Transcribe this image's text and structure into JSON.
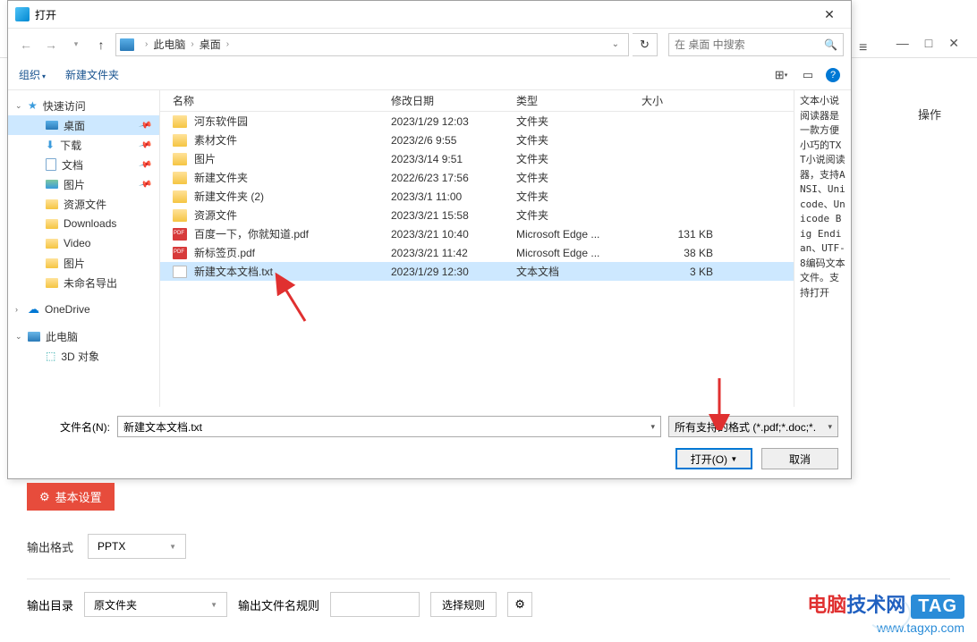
{
  "bg": {
    "operation_label": "操作"
  },
  "dialog": {
    "title": "打开",
    "breadcrumb": {
      "root": "此电脑",
      "folder": "桌面"
    },
    "search_placeholder": "在 桌面 中搜索",
    "toolbar": {
      "organize": "组织",
      "newfolder": "新建文件夹"
    },
    "columns": {
      "name": "名称",
      "date": "修改日期",
      "type": "类型",
      "size": "大小"
    },
    "sidebar": {
      "quick": "快速访问",
      "items": [
        {
          "label": "桌面",
          "pinned": true,
          "selected": true,
          "icon": "desktop"
        },
        {
          "label": "下载",
          "pinned": true,
          "icon": "download"
        },
        {
          "label": "文档",
          "pinned": true,
          "icon": "doc"
        },
        {
          "label": "图片",
          "pinned": true,
          "icon": "pic"
        },
        {
          "label": "资源文件",
          "icon": "folder"
        },
        {
          "label": "Downloads",
          "icon": "folder"
        },
        {
          "label": "Video",
          "icon": "folder"
        },
        {
          "label": "图片",
          "icon": "folder"
        },
        {
          "label": "未命名导出",
          "icon": "folder"
        }
      ],
      "onedrive": "OneDrive",
      "thispc": "此电脑",
      "threed": "3D 对象"
    },
    "files": [
      {
        "name": "河东软件园",
        "date": "2023/1/29 12:03",
        "type": "文件夹",
        "size": "",
        "icon": "folder"
      },
      {
        "name": "素材文件",
        "date": "2023/2/6 9:55",
        "type": "文件夹",
        "size": "",
        "icon": "folder"
      },
      {
        "name": "图片",
        "date": "2023/3/14 9:51",
        "type": "文件夹",
        "size": "",
        "icon": "folder"
      },
      {
        "name": "新建文件夹",
        "date": "2022/6/23 17:56",
        "type": "文件夹",
        "size": "",
        "icon": "folder"
      },
      {
        "name": "新建文件夹 (2)",
        "date": "2023/3/1 11:00",
        "type": "文件夹",
        "size": "",
        "icon": "folder"
      },
      {
        "name": "资源文件",
        "date": "2023/3/21 15:58",
        "type": "文件夹",
        "size": "",
        "icon": "folder"
      },
      {
        "name": "百度一下，你就知道.pdf",
        "date": "2023/3/21 10:40",
        "type": "Microsoft Edge ...",
        "size": "131 KB",
        "icon": "pdf"
      },
      {
        "name": "新标签页.pdf",
        "date": "2023/3/21 11:42",
        "type": "Microsoft Edge ...",
        "size": "38 KB",
        "icon": "pdf"
      },
      {
        "name": "新建文本文档.txt",
        "date": "2023/1/29 12:30",
        "type": "文本文档",
        "size": "3 KB",
        "icon": "txt",
        "selected": true
      }
    ],
    "preview_text": "文本小说阅读器是一款方便小巧的TXT小说阅读器，支持ANSI、Unicode、Unicode Big Endian、UTF-8编码文本文件。支持打开",
    "filename_label": "文件名(N):",
    "filename_value": "新建文本文档.txt",
    "filetype_value": "所有支持的格式 (*.pdf;*.doc;*.",
    "open_btn": "打开(O)",
    "cancel_btn": "取消"
  },
  "app": {
    "basic_settings": "基本设置",
    "output_format_label": "输出格式",
    "output_format_value": "PPTX",
    "output_dir_label": "输出目录",
    "output_dir_value": "原文件夹",
    "output_rule_label": "输出文件名规则",
    "rule_btn": "选择规则"
  },
  "watermark": {
    "brand_red": "电脑",
    "brand_blue": "技术网",
    "tag": "TAG",
    "url": "www.tagxp.com"
  }
}
